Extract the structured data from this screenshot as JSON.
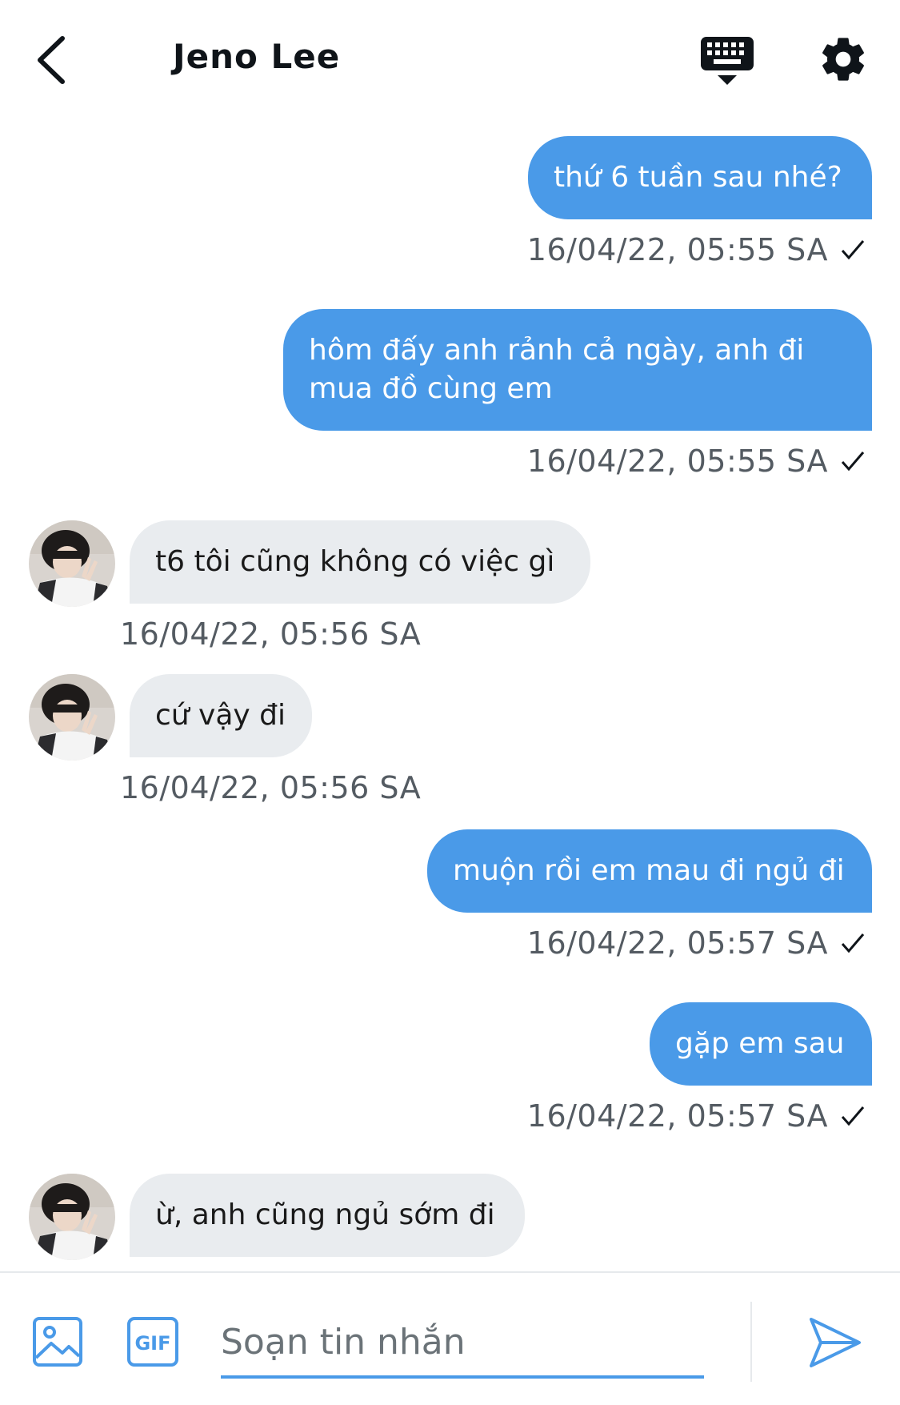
{
  "header": {
    "contact_name": "Jeno Lee"
  },
  "messages": [
    {
      "direction": "out",
      "text": "thứ 6 tuần sau nhé?",
      "timestamp": "16/04/22, 05:55 SA",
      "status": "sent"
    },
    {
      "direction": "out",
      "text": "hôm đấy anh rảnh cả ngày, anh đi mua đồ cùng em",
      "timestamp": "16/04/22, 05:55 SA",
      "status": "sent"
    },
    {
      "direction": "in",
      "text": "t6 tôi cũng không có việc gì",
      "timestamp": "16/04/22, 05:56 SA"
    },
    {
      "direction": "in",
      "text": "cứ vậy đi",
      "timestamp": "16/04/22, 05:56 SA"
    },
    {
      "direction": "out",
      "text": "muộn rồi em mau đi ngủ đi",
      "timestamp": "16/04/22, 05:57 SA",
      "status": "sent"
    },
    {
      "direction": "out",
      "text": "gặp em sau",
      "timestamp": "16/04/22, 05:57 SA",
      "status": "sent"
    },
    {
      "direction": "in",
      "text": "ừ, anh cũng ngủ sớm đi"
    }
  ],
  "composer": {
    "placeholder": "Soạn tin nhắn",
    "value": ""
  },
  "icons": {
    "back": "chevron-left-icon",
    "keyboard": "keyboard-icon",
    "settings": "gear-icon",
    "read_receipt": "check-icon",
    "image": "image-icon",
    "gif": "gif-icon",
    "send": "send-icon"
  },
  "colors": {
    "accent": "#4a9ae8",
    "incoming_bubble": "#e9ecef",
    "timestamp": "#545b62"
  }
}
